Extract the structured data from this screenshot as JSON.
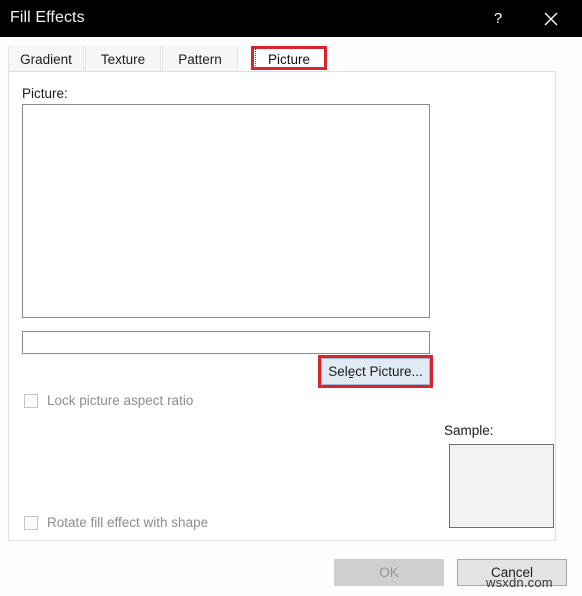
{
  "window": {
    "title": "Fill Effects",
    "titlebar_bg": "#000000",
    "help_icon": "question-mark-icon",
    "close_icon": "close-x-icon"
  },
  "tabs": [
    {
      "id": "gradient",
      "label": "Gradient",
      "selected": false
    },
    {
      "id": "texture",
      "label": "Texture",
      "selected": false
    },
    {
      "id": "pattern",
      "label": "Pattern",
      "selected": false
    },
    {
      "id": "picture",
      "label": "Picture",
      "selected": true
    }
  ],
  "highlight_color": "#d9242b",
  "picture_tab": {
    "picture_label": "Picture:",
    "preview_value": "",
    "path_input": {
      "value": "",
      "placeholder": ""
    },
    "select_picture_button": {
      "label": "Select Picture...",
      "state": "hover",
      "highlighted": true
    },
    "checkboxes": [
      {
        "id": "lock-aspect",
        "label": "Lock picture aspect ratio",
        "checked": false,
        "enabled": false
      },
      {
        "id": "rotate-fill",
        "label": "Rotate fill effect with shape",
        "checked": false,
        "enabled": false
      }
    ],
    "sample": {
      "label": "Sample:",
      "fill": "#f2f2f2"
    }
  },
  "footer": {
    "ok_label": "OK",
    "ok_enabled": false,
    "cancel_label": "Cancel"
  },
  "watermark": {
    "text": "wsxdn.com"
  }
}
